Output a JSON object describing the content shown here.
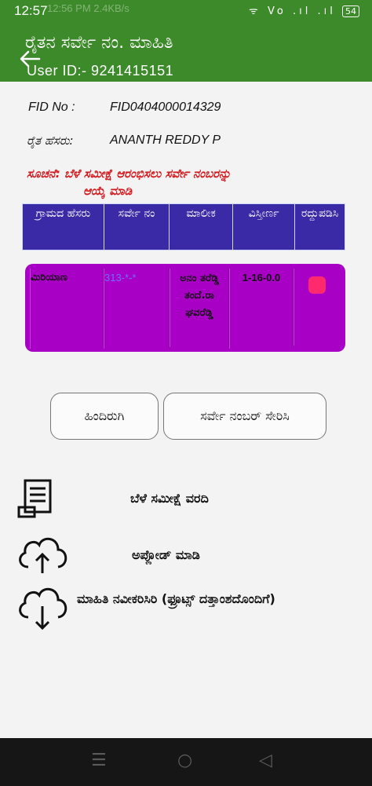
{
  "status_bar": {
    "time": "12:57",
    "ghost_text": "12:56 PM  2.4KB/s",
    "signal_text": "ᯤ  Vo  .ıl  .ıl",
    "battery": "54"
  },
  "app_bar": {
    "title": "ರೈತನ ಸರ್ವೇ ನಂ. ಮಾಹಿತಿ",
    "user_id": "User ID:-  9241415151",
    "back_icon": "arrow-left-icon"
  },
  "details": {
    "fid_label": "FID No :",
    "fid_value": "FID0404000014329",
    "name_label": "ರೈತ ಹೆಸರು:",
    "name_value": "ANANTH REDDY P"
  },
  "note": {
    "line1": "ಸೂಚನೆ: ಬೆಳೆ ಸಮೀಕ್ಷೆ ಆರಂಭಿಸಲು ಸರ್ವೇ ನಂಬರನ್ನು",
    "line2": "ಆಯ್ಕೆ ಮಾಡಿ"
  },
  "table": {
    "headers": [
      "ಗ್ರಾಮದ ಹೆಸರು",
      "ಸರ್ವೇ ನಂ",
      "ಮಾಲೀಕ",
      "ವಿಸ್ತೀರ್ಣ",
      "ರದ್ದುಪಡಿಸಿ"
    ],
    "row": {
      "village": "ಮಿರಿಯಾಣ",
      "survey_no": "313-*-*",
      "owner": "ಅನಂ ತರೆಡ್ಡಿ ತಂದೆ.ರಾ ಘವರೆಡ್ಡಿ",
      "extent": "1-16-0.0",
      "cancel_icon": "delete-icon"
    },
    "row_color": "#a800c4",
    "header_color": "#3a2aa6"
  },
  "buttons": {
    "back": "ಹಿಂದಿರುಗಿ",
    "add_survey": "ಸರ್ವೇ ನಂಬರ್ ಸೇರಿಸಿ"
  },
  "menu": [
    {
      "icon": "report-icon",
      "label": "ಬೆಳೆ ಸಮೀಕ್ಷೆ ವರದಿ"
    },
    {
      "icon": "cloud-upload-icon",
      "label": "ಅಪ್ಲೋಡ್ ಮಾಡಿ"
    },
    {
      "icon": "cloud-download-icon",
      "label": "ಮಾಹಿತಿ ನವೀಕರಿಸಿರಿ (ಫ್ರೂಟ್ಸ್ ದತ್ತಾಂಶದೊಂದಿಗೆ)"
    }
  ],
  "navbar": {
    "recents": "☰",
    "home": "○",
    "back": "◁"
  },
  "colors": {
    "brand_green": "#3d8a2a",
    "note_red": "#d1191e"
  }
}
